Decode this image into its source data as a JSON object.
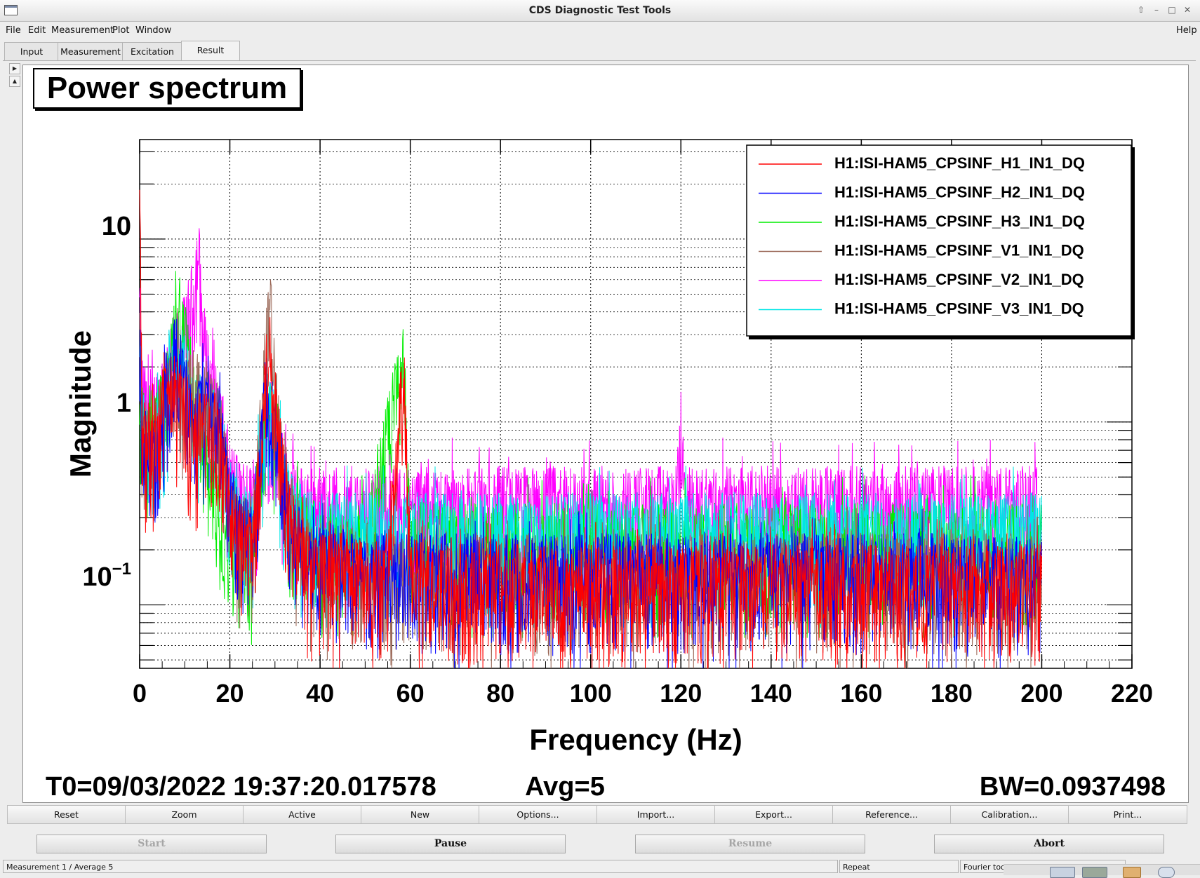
{
  "window": {
    "title": "CDS Diagnostic Test Tools"
  },
  "menu": {
    "file": "File",
    "edit": "Edit",
    "measurement": "Measurement",
    "plot": "Plot",
    "window": "Window",
    "help": "Help"
  },
  "tabs": [
    "Input",
    "Measurement",
    "Excitation",
    "Result"
  ],
  "active_tab": "Result",
  "plot": {
    "title": "Power spectrum",
    "t0": "T0=09/03/2022 19:37:20.017578",
    "avg": "Avg=5",
    "bw": "BW=0.0937498"
  },
  "plot_buttons": [
    "Reset",
    "Zoom",
    "Active",
    "New",
    "Options...",
    "Import...",
    "Export...",
    "Reference...",
    "Calibration...",
    "Print..."
  ],
  "command_buttons": {
    "start": "Start",
    "pause": "Pause",
    "resume": "Resume",
    "abort": "Abort"
  },
  "status": {
    "message": "Measurement 1 / Average 5",
    "repeat": "Repeat",
    "fourier": "Fourier tools"
  },
  "colors": {
    "h1": "#ff0000",
    "h2": "#0000ff",
    "h3": "#00ee00",
    "v1": "#996655",
    "v2": "#ff00ff",
    "v3": "#00e6e6"
  },
  "chart_data": {
    "type": "line",
    "xlabel": "Frequency (Hz)",
    "ylabel": "Magnitude",
    "xlim": [
      0,
      220
    ],
    "ylim": [
      0.045,
      35
    ],
    "y_scale": "log",
    "grid": true,
    "legend_position": "top-right",
    "x_ticks": [
      "0",
      "20",
      "40",
      "60",
      "80",
      "100",
      "120",
      "140",
      "160",
      "180",
      "200",
      "220"
    ],
    "y_ticks": [
      "10",
      "1",
      "10^-1"
    ],
    "series": [
      {
        "name": "H1:ISI-HAM5_CPSINF_H1_IN1_DQ",
        "color": "#ff0000",
        "x": [
          0,
          0.5,
          2,
          5,
          8,
          10,
          12,
          14,
          16,
          18,
          20,
          22,
          25,
          28,
          29,
          30,
          33,
          36,
          40,
          45,
          50,
          55,
          58.5,
          60,
          62,
          70,
          80,
          100,
          120,
          140,
          160,
          180,
          200
        ],
        "y": [
          26,
          1.0,
          0.7,
          1.2,
          1.5,
          1.2,
          0.8,
          1.0,
          0.8,
          0.8,
          0.3,
          0.22,
          0.2,
          1.8,
          2.5,
          1.2,
          0.3,
          0.18,
          0.15,
          0.15,
          0.14,
          0.14,
          2.0,
          0.14,
          0.14,
          0.13,
          0.13,
          0.13,
          0.13,
          0.13,
          0.13,
          0.13,
          0.13
        ]
      },
      {
        "name": "H1:ISI-HAM5_CPSINF_H2_IN1_DQ",
        "color": "#0000ff",
        "x": [
          0,
          0.5,
          2,
          5,
          8,
          10,
          12,
          14,
          16,
          18,
          20,
          22,
          25,
          28,
          30,
          33,
          36,
          40,
          50,
          60,
          70,
          80,
          100,
          120,
          140,
          160,
          180,
          200
        ],
        "y": [
          3.5,
          1.0,
          0.6,
          1.0,
          2.5,
          1.5,
          0.9,
          1.2,
          1.0,
          0.9,
          0.35,
          0.25,
          0.22,
          1.5,
          1.0,
          0.3,
          0.2,
          0.17,
          0.16,
          0.15,
          0.15,
          0.15,
          0.15,
          0.15,
          0.15,
          0.15,
          0.15,
          0.14
        ]
      },
      {
        "name": "H1:ISI-HAM5_CPSINF_H3_IN1_DQ",
        "color": "#00ee00",
        "x": [
          0,
          0.5,
          2,
          5,
          8,
          9,
          11,
          13,
          15,
          18,
          20,
          22,
          25,
          28,
          30,
          33,
          36,
          40,
          50,
          58.5,
          60,
          70,
          80,
          100,
          120,
          140,
          160,
          180,
          200
        ],
        "y": [
          2.0,
          1.0,
          0.7,
          1.2,
          3.0,
          4.5,
          2.0,
          1.0,
          0.5,
          0.3,
          0.25,
          0.22,
          0.2,
          1.5,
          1.0,
          0.3,
          0.25,
          0.22,
          0.22,
          2.2,
          0.22,
          0.22,
          0.22,
          0.22,
          0.22,
          0.22,
          0.22,
          0.22,
          0.22
        ]
      },
      {
        "name": "H1:ISI-HAM5_CPSINF_V1_IN1_DQ",
        "color": "#996655",
        "x": [
          0,
          0.5,
          2,
          5,
          8,
          10,
          12,
          14,
          16,
          18,
          20,
          22,
          25,
          28,
          29,
          30,
          33,
          36,
          40,
          50,
          60,
          80,
          100,
          120,
          140,
          160,
          180,
          200
        ],
        "y": [
          3.0,
          1.0,
          0.7,
          1.0,
          2.0,
          1.5,
          1.5,
          1.5,
          1.2,
          0.9,
          0.35,
          0.25,
          0.22,
          2.5,
          4.0,
          1.5,
          0.35,
          0.2,
          0.17,
          0.15,
          0.15,
          0.15,
          0.15,
          0.15,
          0.15,
          0.15,
          0.15,
          0.15
        ]
      },
      {
        "name": "H1:ISI-HAM5_CPSINF_V2_IN1_DQ",
        "color": "#ff00ff",
        "x": [
          0,
          0.5,
          2,
          5,
          8,
          10,
          12,
          13,
          14,
          16,
          18,
          20,
          22,
          25,
          28,
          30,
          33,
          36,
          40,
          50,
          60,
          80,
          100,
          119,
          120,
          121,
          140,
          160,
          180,
          200
        ],
        "y": [
          4.0,
          1.5,
          1.0,
          1.5,
          2.5,
          3.0,
          5.0,
          9.5,
          3.0,
          1.5,
          1.0,
          0.5,
          0.4,
          0.35,
          1.0,
          0.8,
          0.4,
          0.35,
          0.35,
          0.35,
          0.35,
          0.35,
          0.35,
          0.35,
          0.9,
          0.35,
          0.35,
          0.35,
          0.35,
          0.35
        ]
      },
      {
        "name": "H1:ISI-HAM5_CPSINF_V3_IN1_DQ",
        "color": "#00e6e6",
        "x": [
          0,
          0.5,
          2,
          5,
          8,
          10,
          12,
          14,
          16,
          18,
          20,
          22,
          25,
          28,
          30,
          33,
          36,
          40,
          50,
          60,
          80,
          100,
          120,
          140,
          160,
          180,
          200
        ],
        "y": [
          2.5,
          1.0,
          0.7,
          1.0,
          2.0,
          1.8,
          1.2,
          1.2,
          1.0,
          0.8,
          0.4,
          0.3,
          0.25,
          1.3,
          1.0,
          0.35,
          0.28,
          0.25,
          0.25,
          0.25,
          0.25,
          0.25,
          0.25,
          0.25,
          0.25,
          0.25,
          0.25
        ]
      }
    ]
  }
}
